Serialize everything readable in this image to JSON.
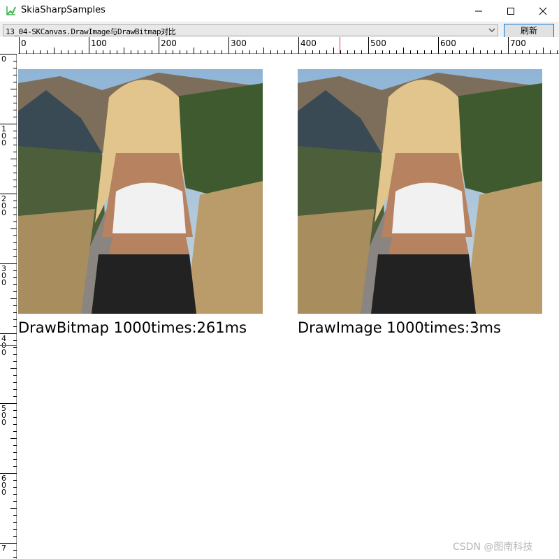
{
  "window": {
    "title": "SkiaSharpSamples",
    "controls": {
      "minimize": "minimize-icon",
      "maximize": "maximize-icon",
      "close": "close-icon"
    }
  },
  "toolbar": {
    "sample_select": {
      "value": "13_04-SKCanvas.DrawImage与DrawBitmap对比"
    },
    "refresh_label": "刷新"
  },
  "rulers": {
    "horizontal_labels": [
      "0",
      "100",
      "200",
      "300",
      "400",
      "500",
      "600",
      "700"
    ],
    "vertical_labels": [
      [
        "0"
      ],
      [
        "1",
        "0",
        "0"
      ],
      [
        "2",
        "0",
        "0"
      ],
      [
        "3",
        "0",
        "0"
      ],
      [
        "4",
        "0",
        "0"
      ],
      [
        "5",
        "0",
        "0"
      ],
      [
        "6",
        "0",
        "0"
      ],
      [
        "7"
      ]
    ],
    "marker_color": "#e53935"
  },
  "canvas": {
    "left_caption": "DrawBitmap 1000times:261ms",
    "right_caption": "DrawImage 1000times:3ms"
  },
  "watermark": "CSDN @图南科技"
}
